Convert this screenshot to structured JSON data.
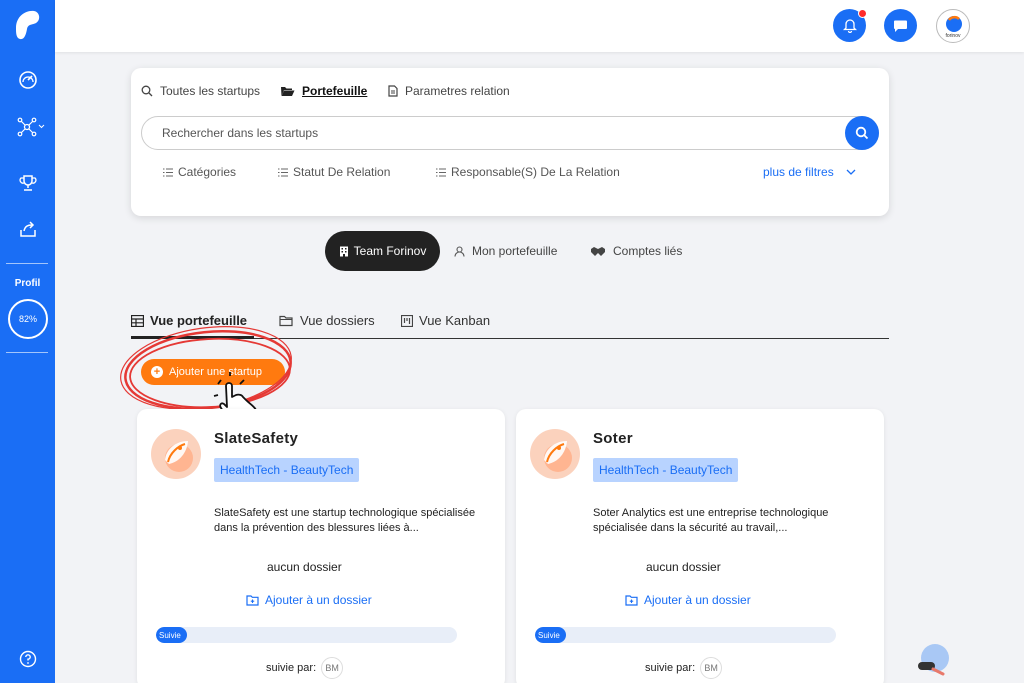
{
  "sidebar": {
    "items": [
      {
        "name": "dashboard-icon"
      },
      {
        "name": "network-icon"
      },
      {
        "name": "trophy-icon"
      },
      {
        "name": "export-icon"
      }
    ],
    "profil_label": "Profil",
    "profil_percent": "82%",
    "profil_value": 0.82
  },
  "search_panel": {
    "tabs": [
      {
        "label": "Toutes les startups",
        "icon": "search-icon"
      },
      {
        "label": "Portefeuille",
        "icon": "folder-open-icon",
        "active": true
      },
      {
        "label": "Parametres relation",
        "icon": "document-icon"
      }
    ],
    "search_placeholder": "Rechercher dans les startups",
    "filters": [
      "Catégories",
      "Statut De Relation",
      "Responsable(S) De La Relation"
    ],
    "more_filters": "plus de filtres"
  },
  "view_switch": {
    "team": "Team Forinov",
    "mine": "Mon portefeuille",
    "linked": "Comptes liés"
  },
  "view_tabs": [
    {
      "label": "Vue portefeuille",
      "active": true
    },
    {
      "label": "Vue dossiers"
    },
    {
      "label": "Vue Kanban"
    }
  ],
  "add_startup_label": "Ajouter une startup",
  "avatar_text": "forinov",
  "cards": [
    {
      "name": "SlateSafety",
      "tag": "HealthTech - BeautyTech",
      "description": "SlateSafety est une startup technologique spécialisée dans la prévention des blessures liées à...",
      "no_folder": "aucun dossier",
      "add_folder": "Ajouter à un dossier",
      "status": "Suivie",
      "status_progress": 0.1,
      "followed_by": "suivie par:",
      "follower": "BM"
    },
    {
      "name": "Soter",
      "tag": "HealthTech - BeautyTech",
      "description": "Soter Analytics est une entreprise technologique spécialisée dans la sécurité au travail,...",
      "no_folder": "aucun dossier",
      "add_folder": "Ajouter à un dossier",
      "status": "Suivie",
      "status_progress": 0.1,
      "followed_by": "suivie par:",
      "follower": "BM"
    }
  ],
  "colors": {
    "primary": "#1a6ef5",
    "accent": "#ff7a0f",
    "annotation": "#e53935"
  }
}
